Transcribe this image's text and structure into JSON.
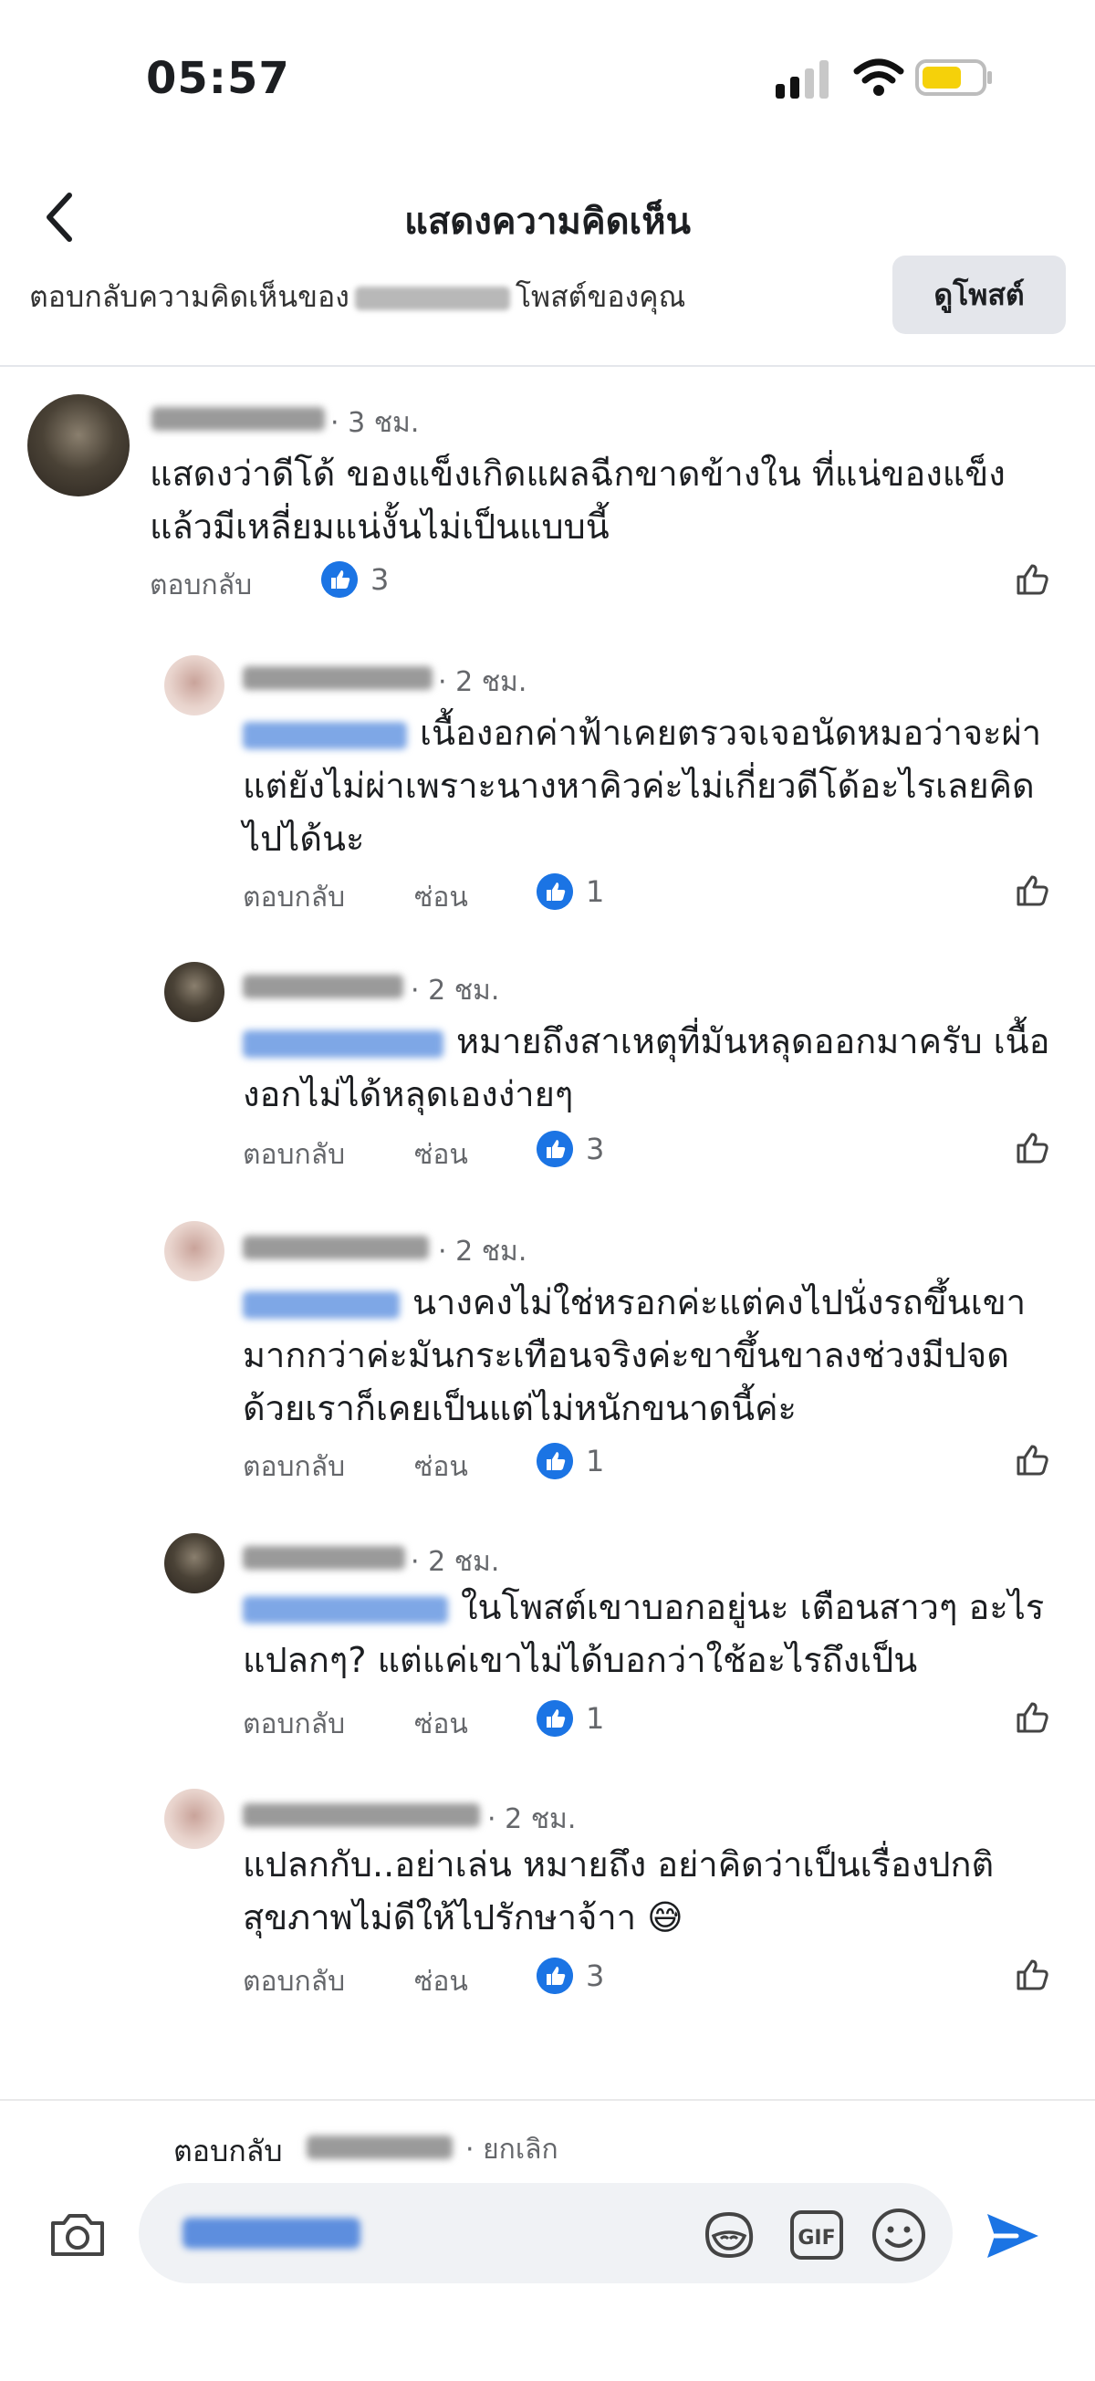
{
  "status_bar": {
    "time": "05:57"
  },
  "header": {
    "title": "แสดงความคิดเห็น",
    "back_icon": "chevron-left-icon"
  },
  "context_bar": {
    "prefix": "ตอบกลับความคิดเห็นของ",
    "suffix": "โพสต์ของคุณ",
    "view_post_label": "ดูโพสต์"
  },
  "comments": [
    {
      "time": "· 3 ชม.",
      "text": "แสดงว่าดีโด้ ของแข็งเกิดแผลฉีกขาดข้างใน ที่แน่ของแข็ง แล้วมีเหลี่ยมแน่งั้นไม่เป็นแบบนี้",
      "reply": "ตอบกลับ",
      "likes": "3",
      "avatar": "dark"
    },
    {
      "time": "· 2 ชม.",
      "text": "เนื้องอกค่าฟ้าเคยตรวจเจอนัดหมอว่าจะผ่า แต่ยังไม่ผ่าเพราะนางหาคิวค่ะไม่เกี่ยวดีโด้อะไรเลยคิด ไปได้นะ",
      "reply": "ตอบกลับ",
      "hide": "ซ่อน",
      "likes": "1",
      "avatar": "light"
    },
    {
      "time": "· 2 ชม.",
      "text": "หมายถึงสาเหตุที่มันหลุดออกมาครับ เนื้องอกไม่ได้หลุดเองง่ายๆ",
      "reply": "ตอบกลับ",
      "hide": "ซ่อน",
      "likes": "3",
      "avatar": "dark"
    },
    {
      "time": "· 2 ชม.",
      "text": "นางคงไม่ใช่หรอกค่ะแต่คงไปนั่งรถขึ้นเขา มากกว่าค่ะมันกระเทือนจริงค่ะขาขึ้นขาลงช่วงมีปจด ด้วยเราก็เคยเป็นแต่ไม่หนักขนาดนี้ค่ะ",
      "reply": "ตอบกลับ",
      "hide": "ซ่อน",
      "likes": "1",
      "avatar": "light"
    },
    {
      "time": "· 2 ชม.",
      "text": "ในโพสต์เขาบอกอยู่นะ เตือนสาวๆ อะไร แปลกๆ? แต่แค่เขาไม่ได้บอกว่าใช้อะไรถึงเป็น",
      "reply": "ตอบกลับ",
      "hide": "ซ่อน",
      "likes": "1",
      "avatar": "dark"
    },
    {
      "time": "· 2 ชม.",
      "text": "แปลกกับ..อย่าเล่น หมายถึง อย่าคิดว่าเป็นเรื่องปกติ สุขภาพไม่ดีให้ไปรักษาจ้าา 😅",
      "reply": "ตอบกลับ",
      "hide": "ซ่อน",
      "likes": "3",
      "avatar": "light"
    }
  ],
  "composer": {
    "reply_to_label": "ตอบกลับ",
    "cancel_label": "· ยกเลิก",
    "icons": [
      "camera-icon",
      "sticker-icon",
      "gif-icon",
      "emoji-icon",
      "send-icon"
    ],
    "gif_text": "GIF"
  },
  "colors": {
    "accent": "#1b74e4",
    "muted": "#65676b",
    "bubble": "#f0f2f5"
  }
}
